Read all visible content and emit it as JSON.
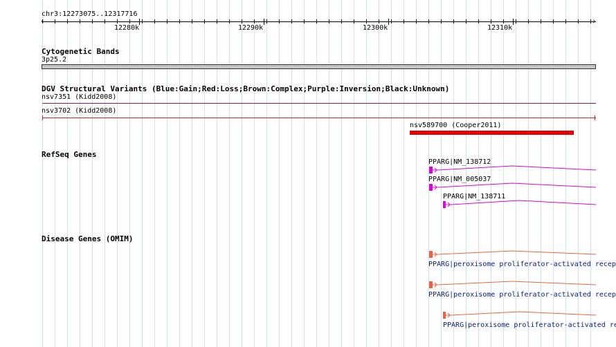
{
  "ruler": {
    "region": "chr3:12273075..12317716",
    "ticks": [
      "12280k",
      "12290k",
      "12300k",
      "12310k"
    ]
  },
  "tracks": {
    "cytobands": {
      "title": "Cytogenetic Bands",
      "band": "3p25.2"
    },
    "dgv": {
      "title": "DGV Structural Variants (Blue:Gain;Red:Loss;Brown:Complex;Purple:Inversion;Black:Unknown)",
      "features": [
        {
          "label": "nsv7351 (Kidd2008)",
          "color": "#8b1a5c"
        },
        {
          "label": "nsv3702 (Kidd2008)",
          "color": "#e02020"
        },
        {
          "label": "nsv589700 (Cooper2011)",
          "color": "#e60000"
        }
      ]
    },
    "refseq": {
      "title": "RefSeq Genes",
      "color": "#e000e0",
      "transcripts": [
        {
          "label": "PPARG|NM_138712"
        },
        {
          "label": "PPARG|NM_005037"
        },
        {
          "label": "PPARG|NM_138711"
        }
      ]
    },
    "omim": {
      "title": "Disease Genes (OMIM)",
      "color": "#f06040",
      "label_color": "#0a1d7a",
      "features": [
        {
          "label": "PPARG|peroxisome proliferator-activated receptor gamma"
        },
        {
          "label": "PPARG|peroxisome proliferator-activated receptor gamma"
        },
        {
          "label": "PPARG|peroxisome proliferator-activated receptor gamma"
        }
      ]
    }
  }
}
